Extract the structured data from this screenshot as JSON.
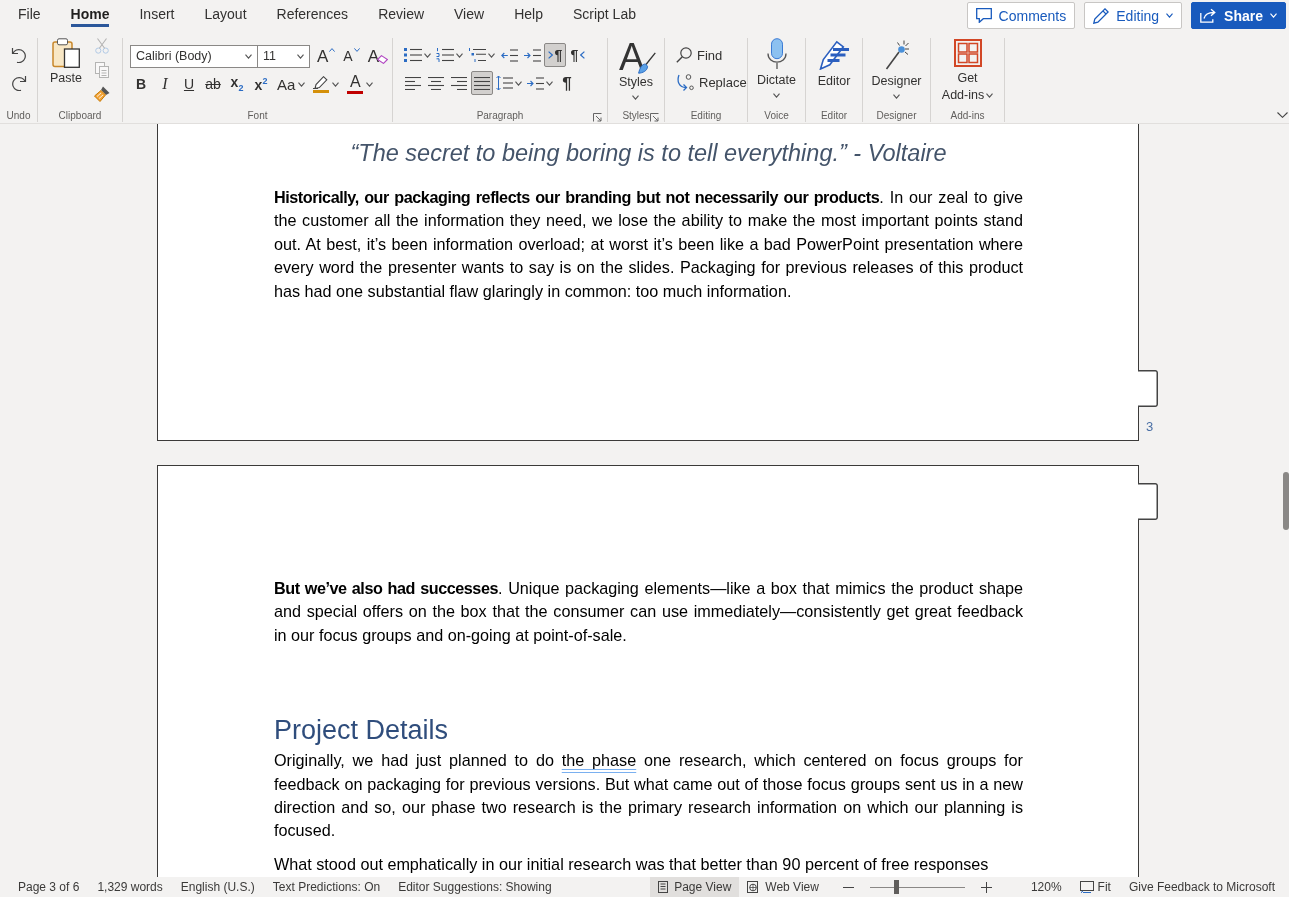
{
  "menu_tabs": [
    {
      "label": "File",
      "selected": false
    },
    {
      "label": "Home",
      "selected": true
    },
    {
      "label": "Insert",
      "selected": false
    },
    {
      "label": "Layout",
      "selected": false
    },
    {
      "label": "References",
      "selected": false
    },
    {
      "label": "Review",
      "selected": false
    },
    {
      "label": "View",
      "selected": false
    },
    {
      "label": "Help",
      "selected": false
    },
    {
      "label": "Script Lab",
      "selected": false
    }
  ],
  "header_buttons": [
    {
      "kind": "comments",
      "label": "Comments"
    },
    {
      "kind": "editing",
      "label": "Editing"
    },
    {
      "kind": "share",
      "label": "Share"
    }
  ],
  "ribbon_groups": [
    {
      "kind": "undo",
      "label": "Undo",
      "launcher": false,
      "controls": [
        {
          "kind": "undo"
        },
        {
          "kind": "redo"
        }
      ]
    },
    {
      "kind": "clipboard",
      "label": "Clipboard",
      "launcher": false,
      "controls": [
        {
          "kind": "paste",
          "label": "Paste",
          "disabled": false
        },
        {
          "kind": "cut",
          "disabled": true
        },
        {
          "kind": "copy",
          "disabled": true
        },
        {
          "kind": "format_painter",
          "disabled": false
        }
      ]
    },
    {
      "kind": "font",
      "label": "Font",
      "launcher": false,
      "top_row": [
        {
          "kind": "font_name",
          "value": "Calibri (Body)"
        },
        {
          "kind": "font_size",
          "value": "11"
        },
        {
          "kind": "grow_font",
          "glyph": "A"
        },
        {
          "kind": "shrink_font",
          "glyph": "A"
        },
        {
          "kind": "clear_formatting",
          "glyph": "A"
        }
      ],
      "bottom_row": [
        {
          "kind": "bold",
          "glyph": "B"
        },
        {
          "kind": "italic",
          "glyph": "I"
        },
        {
          "kind": "underline",
          "glyph": "U"
        },
        {
          "kind": "strikethrough",
          "glyph": "ab"
        },
        {
          "kind": "subscript",
          "glyph": "x$_{2}$"
        },
        {
          "kind": "superscript",
          "glyph": "x$^{2}$"
        },
        {
          "kind": "change_case",
          "glyph": "Aa"
        },
        {
          "kind": "highlight",
          "color": "#d4900a"
        },
        {
          "kind": "font_color",
          "glyph": "A",
          "color": "#c00000"
        }
      ]
    },
    {
      "kind": "paragraph",
      "label": "Paragraph",
      "launcher": true,
      "top_row": [
        {
          "kind": "bullets",
          "selected": false
        },
        {
          "kind": "numbering",
          "selected": false
        },
        {
          "kind": "multilevel",
          "selected": false
        },
        {
          "kind": "decrease_indent",
          "selected": false
        },
        {
          "kind": "increase_indent",
          "selected": false
        },
        {
          "kind": "ltr",
          "glyph": "¶",
          "selected": true
        },
        {
          "kind": "rtl",
          "glyph": "¶",
          "selected": false
        }
      ],
      "bottom_row": [
        {
          "kind": "align_left",
          "selected": false
        },
        {
          "kind": "align_center",
          "selected": false
        },
        {
          "kind": "align_right",
          "selected": false
        },
        {
          "kind": "justify",
          "selected": true
        },
        {
          "kind": "line_spacing",
          "selected": false
        },
        {
          "kind": "indentation",
          "selected": false
        },
        {
          "kind": "formatting_marks",
          "glyph": "¶",
          "selected": false
        }
      ]
    },
    {
      "kind": "styles",
      "label": "Styles",
      "launcher": true,
      "controls": [
        {
          "kind": "styles",
          "glyph": "A",
          "label": "Styles"
        }
      ]
    },
    {
      "kind": "editing",
      "label": "Editing",
      "launcher": false,
      "controls": [
        {
          "kind": "find",
          "label": "Find"
        },
        {
          "kind": "replace",
          "label": "Replace"
        }
      ]
    },
    {
      "kind": "voice",
      "label": "Voice",
      "launcher": false,
      "controls": [
        {
          "kind": "dictate",
          "label": "Dictate"
        }
      ]
    },
    {
      "kind": "editor",
      "label": "Editor",
      "launcher": false,
      "controls": [
        {
          "kind": "editor",
          "label": "Editor"
        }
      ]
    },
    {
      "kind": "designer",
      "label": "Designer",
      "launcher": false,
      "controls": [
        {
          "kind": "designer",
          "label": "Designer"
        }
      ]
    },
    {
      "kind": "addins",
      "label": "Add-ins",
      "launcher": false,
      "controls": [
        {
          "kind": "get_addins",
          "label": "Get Add-ins"
        }
      ]
    }
  ],
  "document": {
    "pages": [
      {
        "page_number": "3",
        "blocks": [
          {
            "kind": "quote",
            "text": "“The secret to being boring is to tell everything.” - Voltaire"
          },
          {
            "kind": "paragraph",
            "text": "**Historically, our packaging reflects our branding but not necessarily our products**. In our zeal to give the customer all the information they need, we lose the ability to make the most important points stand out. At best, it’s been information overload; at worst it’s been like a bad PowerPoint presentation where every word the presenter wants to say is on the slides. Packaging for previous releases of this product has had one substantial flaw glaringly in common: too much information."
          }
        ]
      },
      {
        "blocks": [
          {
            "kind": "paragraph",
            "text": "**But we’ve also had successes**. Unique packaging elements—like a box that mimics the product shape and special offers on the box that the consumer can use immediately—consistently get great feedback in our focus groups and on-going at point-of-sale."
          },
          {
            "kind": "heading",
            "text": "Project Details"
          },
          {
            "kind": "paragraph",
            "segments": [
              {
                "text": "Originally, we had just planned to do ",
                "suggestion": false
              },
              {
                "text": "the phase",
                "suggestion": true
              },
              {
                "text": " one research, which centered on focus groups for feedback on packaging for previous versions. But what came out of those focus groups sent us in a new direction and so, our phase two research is the primary research information on which our planning is focused.",
                "suggestion": false
              }
            ]
          },
          {
            "kind": "paragraph",
            "text": "What stood out emphatically in our initial research was that better than 90 percent of free responses"
          }
        ]
      }
    ]
  },
  "status_bar": {
    "items": [
      {
        "label": "Page 3 of 6"
      },
      {
        "label": "1,329 words"
      },
      {
        "label": "English (U.S.)"
      },
      {
        "label": "Text Predictions: On"
      },
      {
        "label": "Editor Suggestions: Showing"
      }
    ],
    "views": [
      {
        "kind": "page",
        "label": "Page View",
        "selected": true
      },
      {
        "kind": "web",
        "label": "Web View",
        "selected": false
      }
    ],
    "zoom": {
      "level": 0.28,
      "reading": "120%"
    },
    "fit": {
      "label": "Fit"
    },
    "feedback": {
      "label": "Give Feedback to Microsoft"
    }
  }
}
